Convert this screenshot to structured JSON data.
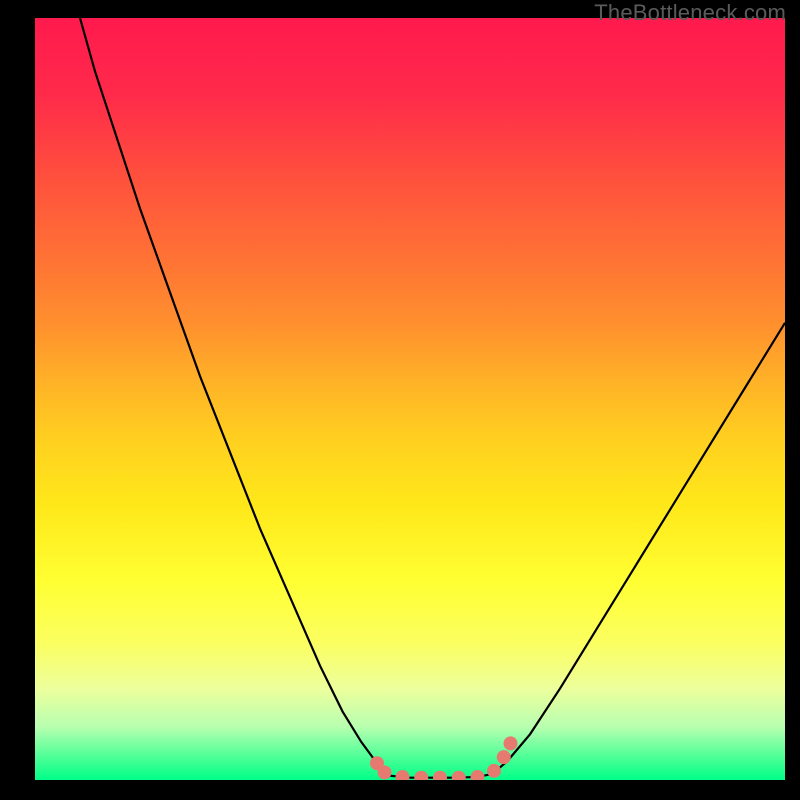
{
  "watermark": "TheBottleneck.com",
  "colors": {
    "background": "#000000",
    "gradient_top": "#ff1a4d",
    "gradient_bottom": "#00ff88",
    "curve": "#000000",
    "markers": "#e67a70"
  },
  "chart_data": {
    "type": "line",
    "title": "",
    "xlabel": "",
    "ylabel": "",
    "xlim": [
      0,
      100
    ],
    "ylim": [
      0,
      100
    ],
    "grid": false,
    "legend": false,
    "series": [
      {
        "name": "left-curve",
        "x": [
          6,
          8,
          10,
          14,
          18,
          22,
          26,
          30,
          34,
          38,
          41,
          43.5,
          45.6,
          47
        ],
        "y": [
          100,
          93,
          87,
          75,
          64,
          53,
          43,
          33,
          24,
          15,
          9,
          5,
          2.2,
          0.6
        ]
      },
      {
        "name": "flat-minimum",
        "x": [
          47,
          50,
          53,
          56,
          59,
          61
        ],
        "y": [
          0.6,
          0.3,
          0.3,
          0.3,
          0.4,
          0.8
        ]
      },
      {
        "name": "right-curve",
        "x": [
          61,
          63,
          66,
          70,
          75,
          80,
          85,
          90,
          95,
          100
        ],
        "y": [
          0.8,
          2.5,
          6,
          12,
          20,
          28,
          36,
          44,
          52,
          60
        ]
      }
    ],
    "markers": [
      {
        "x": 45.6,
        "y": 2.2
      },
      {
        "x": 46.6,
        "y": 1.0
      },
      {
        "x": 49.0,
        "y": 0.4
      },
      {
        "x": 51.5,
        "y": 0.3
      },
      {
        "x": 54.0,
        "y": 0.3
      },
      {
        "x": 56.5,
        "y": 0.3
      },
      {
        "x": 59.0,
        "y": 0.4
      },
      {
        "x": 61.2,
        "y": 1.2
      },
      {
        "x": 62.5,
        "y": 3.0
      },
      {
        "x": 63.4,
        "y": 4.8
      }
    ]
  }
}
